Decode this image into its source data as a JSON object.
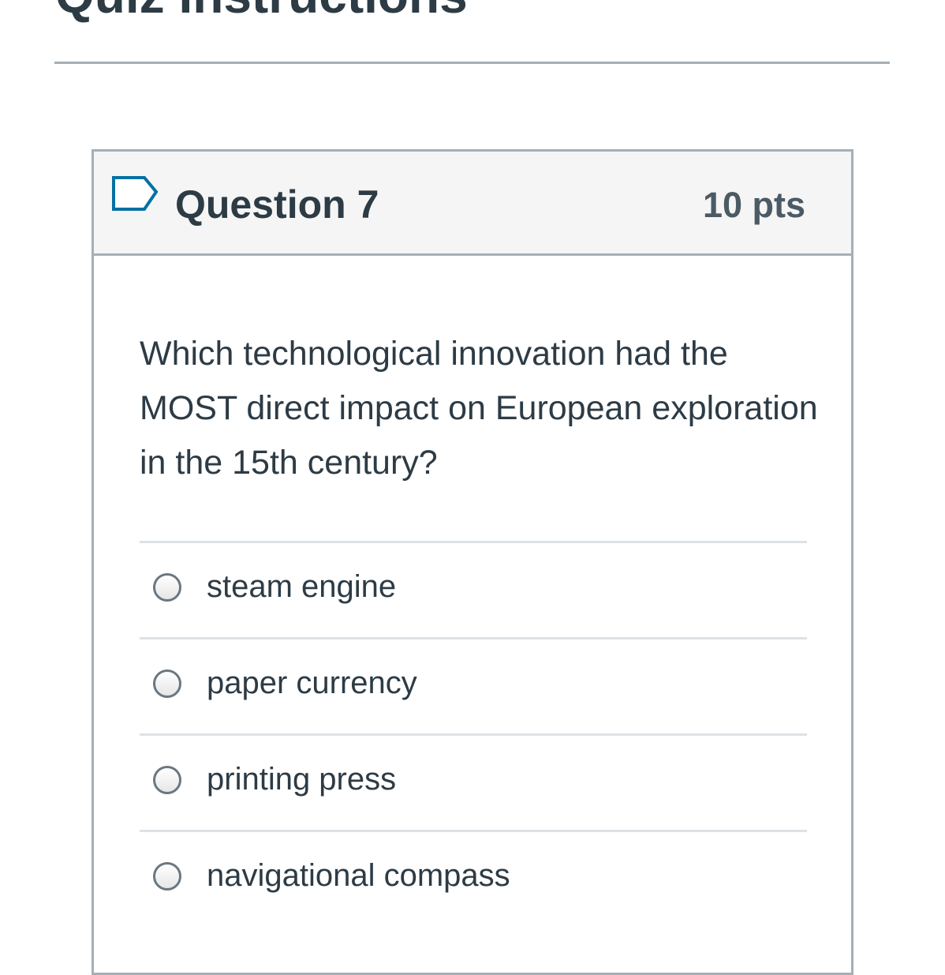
{
  "page": {
    "title": "Quiz Instructions"
  },
  "question": {
    "name": "Question 7",
    "points": "10 pts",
    "text": "Which technological innovation had the MOST direct impact on European exploration in the 15th century?",
    "flag_icon": "flag-outline-icon",
    "answers": [
      {
        "label": "steam engine",
        "selected": false
      },
      {
        "label": "paper currency",
        "selected": false
      },
      {
        "label": "printing press",
        "selected": false
      },
      {
        "label": "navigational compass",
        "selected": false
      }
    ]
  },
  "colors": {
    "text": "#2d3b45",
    "border": "#a5afb5",
    "header_bg": "#f5f5f5",
    "flag_outline": "#0770a3"
  }
}
